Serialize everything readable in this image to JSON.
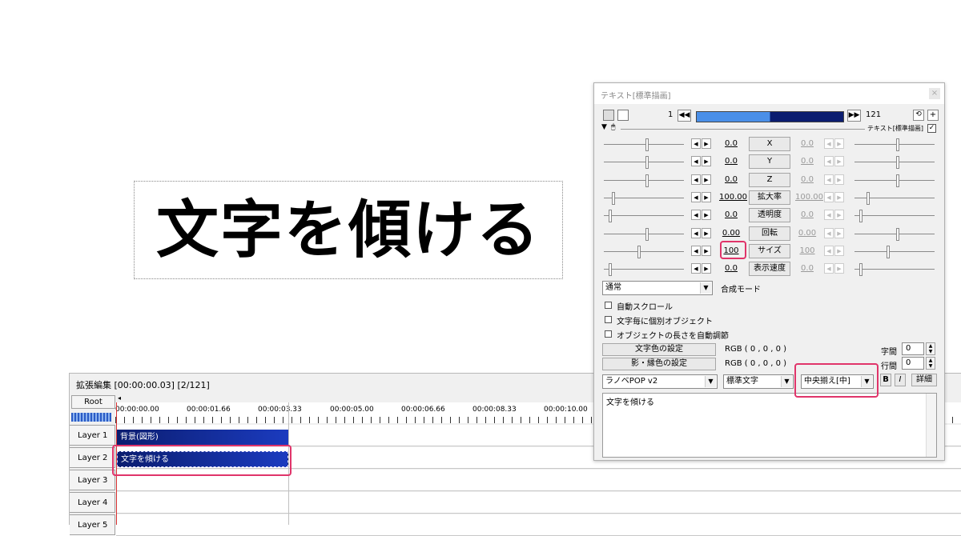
{
  "preview": {
    "text": "文字を傾ける"
  },
  "timeline": {
    "title": "拡張編集 [00:00:00.03] [2/121]",
    "root_label": "Root",
    "ruler_labels": [
      "00:00:00.00",
      "00:00:01.66",
      "00:00:03.33",
      "00:00:05.00",
      "00:00:06.66",
      "00:00:08.33",
      "00:00:10.00"
    ],
    "layers": [
      "Layer 1",
      "Layer 2",
      "Layer 3",
      "Layer 4",
      "Layer 5"
    ],
    "clips": {
      "background": "背景(図形)",
      "text": "文字を傾ける"
    }
  },
  "dialog": {
    "title": "テキスト[標準描画]",
    "frame_start": "1",
    "frame_end": "121",
    "section_label": "テキスト[標準描画]",
    "params": [
      {
        "name": "X",
        "left": "0.0",
        "right": "0.0"
      },
      {
        "name": "Y",
        "left": "0.0",
        "right": "0.0"
      },
      {
        "name": "Z",
        "left": "0.0",
        "right": "0.0"
      },
      {
        "name": "拡大率",
        "left": "100.00",
        "right": "100.00"
      },
      {
        "name": "透明度",
        "left": "0.0",
        "right": "0.0"
      },
      {
        "name": "回転",
        "left": "0.00",
        "right": "0.00"
      },
      {
        "name": "サイズ",
        "left": "100",
        "right": "100"
      },
      {
        "name": "表示速度",
        "left": "0.0",
        "right": "0.0"
      }
    ],
    "blend_mode_value": "通常",
    "blend_mode_label": "合成モード",
    "checkboxes": [
      "自動スクロール",
      "文字毎に個別オブジェクト",
      "オブジェクトの長さを自動調節"
    ],
    "text_color_button": "文字色の設定",
    "text_color_value": "RGB ( 0 , 0 , 0 )",
    "shadow_color_button": "影・縁色の設定",
    "shadow_color_value": "RGB ( 0 , 0 , 0 )",
    "char_spacing_label": "字間",
    "char_spacing_value": "0",
    "line_spacing_label": "行間",
    "line_spacing_value": "0",
    "font_value": "ラノベPOP v2",
    "style_value": "標準文字",
    "align_value": "中央揃え[中]",
    "bold_label": "B",
    "italic_label": "I",
    "detail_label": "詳細",
    "text_content": "文字を傾ける"
  },
  "colors": {
    "highlight": "#e0346a",
    "clip_blue": "#1b3bbf",
    "playhead": "#d83030"
  },
  "icons": {
    "prev_key": "double-left-arrow",
    "next_key": "double-right-arrow",
    "camera": "camera-icon",
    "mouse": "mouse-icon"
  }
}
